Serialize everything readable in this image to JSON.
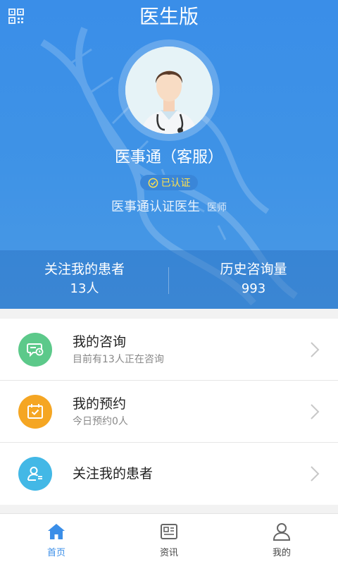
{
  "header": {
    "title": "医生版",
    "doctor_name": "医事通（客服）",
    "verified_label": "已认证",
    "org_label": "医事通认证医生",
    "title_tag": "医师"
  },
  "stats": {
    "followers_label": "关注我的患者",
    "followers_value": "13人",
    "history_label": "历史咨询量",
    "history_value": "993"
  },
  "menu": [
    {
      "title": "我的咨询",
      "subtitle": "目前有13人正在咨询",
      "icon": "consult-icon",
      "color": "#5cc98a"
    },
    {
      "title": "我的预约",
      "subtitle": "今日预约0人",
      "icon": "calendar-icon",
      "color": "#f5a623"
    },
    {
      "title": "关注我的患者",
      "subtitle": "",
      "icon": "patient-icon",
      "color": "#43b8e6"
    }
  ],
  "tabs": [
    {
      "label": "首页",
      "icon": "home-icon",
      "active": true
    },
    {
      "label": "资讯",
      "icon": "news-icon",
      "active": false
    },
    {
      "label": "我的",
      "icon": "profile-icon",
      "active": false
    }
  ],
  "colors": {
    "primary": "#3a8ee8",
    "badge_text": "#ffe14d"
  }
}
